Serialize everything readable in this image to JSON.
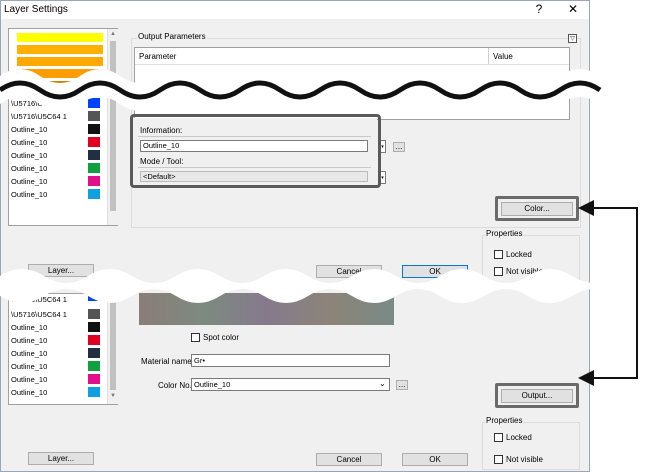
{
  "window": {
    "title": "Layer Settings",
    "help_glyph": "?",
    "close_glyph": "✕"
  },
  "top": {
    "layer_swatches": [
      "#ffff00",
      "#ffb000",
      "#ffa800",
      "#ff9c00",
      "#d08000"
    ],
    "layer_rows": [
      {
        "label": "\\U5716\\U5C64 1",
        "color": "#0040ff"
      },
      {
        "label": "\\U5716\\U5C64 1",
        "color": "#555555"
      },
      {
        "label": "Outline_10",
        "color": "#111111"
      },
      {
        "label": "Outline_10",
        "color": "#e00020"
      },
      {
        "label": "Outline_10",
        "color": "#203040"
      },
      {
        "label": "Outline_10",
        "color": "#10a040"
      },
      {
        "label": "Outline_10",
        "color": "#e0108a"
      },
      {
        "label": "Outline_10",
        "color": "#10a0e0"
      }
    ],
    "layer_button": "Layer...",
    "output_parameters_label": "Output Parameters",
    "table_headers": {
      "parameter": "Parameter",
      "value": "Value"
    },
    "information_label": "Information:",
    "information_value": "Outline_10",
    "mode_tool_label": "Mode / Tool:",
    "mode_tool_value": "<Default>",
    "browse_label": "...",
    "color_button": "Color...",
    "properties_label": "Properties",
    "locked_label": "Locked",
    "not_visible_label": "Not visible",
    "cancel_button": "Cancel",
    "ok_button": "OK"
  },
  "bottom": {
    "layer_rows": [
      {
        "label": "\\U5716\\U5C64 1",
        "color": "#555555"
      },
      {
        "label": "Outline_10",
        "color": "#111111"
      },
      {
        "label": "Outline_10",
        "color": "#e00020"
      },
      {
        "label": "Outline_10",
        "color": "#203040"
      },
      {
        "label": "Outline_10",
        "color": "#10a040"
      },
      {
        "label": "Outline_10",
        "color": "#e0108a"
      },
      {
        "label": "Outline_10",
        "color": "#10a0e0"
      }
    ],
    "first_row_label": "\\U5716\\U5C64 1",
    "spot_color_label": "Spot color",
    "material_name_label": "Material name:",
    "material_name_value": "Gr•",
    "color_no_label": "Color No.:",
    "color_no_value": "Outline_10",
    "browse_label": "...",
    "output_button": "Output...",
    "properties_label": "Properties",
    "locked_label": "Locked",
    "not_visible_label": "Not visible",
    "layer_button": "Layer...",
    "cancel_button": "Cancel",
    "ok_button": "OK"
  }
}
